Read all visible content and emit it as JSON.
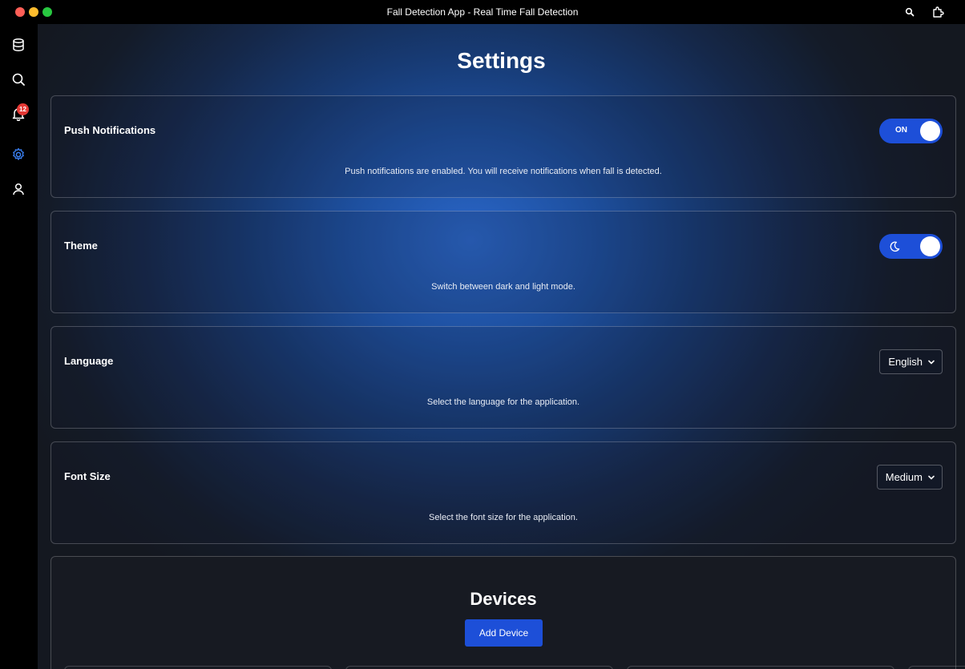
{
  "window": {
    "title": "Fall Detection App - Real Time Fall Detection",
    "toolbar_icons": [
      "search-icon",
      "extension-icon"
    ]
  },
  "sidebar": {
    "items": [
      {
        "icon": "database-icon",
        "active": false
      },
      {
        "icon": "search-icon",
        "active": false
      },
      {
        "icon": "bell-icon",
        "active": false,
        "badge": "12"
      },
      {
        "icon": "gear-icon",
        "active": true
      },
      {
        "icon": "user-icon",
        "active": false
      }
    ]
  },
  "main": {
    "title": "Settings",
    "settings": [
      {
        "label": "Push Notifications",
        "control": "toggle",
        "toggle_text": "ON",
        "state": true,
        "description": "Push notifications are enabled. You will receive notifications when fall is detected."
      },
      {
        "label": "Theme",
        "control": "toggle",
        "toggle_icon": "moon-icon",
        "state": true,
        "description": "Switch between dark and light mode."
      },
      {
        "label": "Language",
        "control": "select",
        "value": "English",
        "description": "Select the language for the application."
      },
      {
        "label": "Font Size",
        "control": "select",
        "value": "Medium",
        "description": "Select the font size for the application."
      }
    ],
    "devices": {
      "title": "Devices",
      "add_button": "Add Device"
    }
  },
  "colors": {
    "accent": "#1d4fd8",
    "badge": "#e53935",
    "active_icon": "#3b82f6"
  }
}
